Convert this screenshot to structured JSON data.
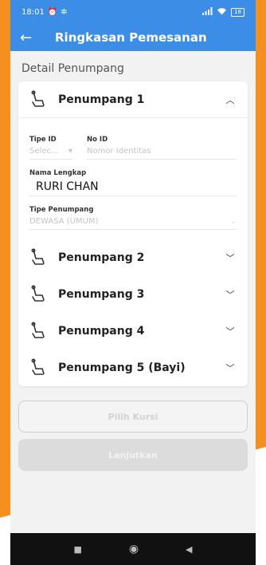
{
  "status_bar": {
    "time": "18:01",
    "left_icons": [
      "alarm-icon",
      "gear-icon"
    ],
    "signal": "4G",
    "battery": "18"
  },
  "app_bar": {
    "title": "Ringkasan Pemesanan",
    "background": "#3b8de6"
  },
  "section_title": "Detail Penumpang",
  "passengers": [
    {
      "label": "Penumpang 1",
      "expanded": true,
      "fields": {
        "tipe_id_label": "Tipe ID",
        "tipe_id_placeholder": "Selec...",
        "no_id_label": "No ID",
        "no_id_placeholder": "Nomor Identitas",
        "nama_label": "Nama Lengkap",
        "nama_value": "RURI CHAN",
        "tipe_penumpang_label": "Tipe Penumpang",
        "tipe_penumpang_value": "DEWASA (UMUM)"
      }
    },
    {
      "label": "Penumpang 2",
      "expanded": false
    },
    {
      "label": "Penumpang 3",
      "expanded": false
    },
    {
      "label": "Penumpang 4",
      "expanded": false
    },
    {
      "label": "Penumpang 5 (Bayi)",
      "expanded": false
    }
  ],
  "buttons": {
    "pilih_kursi": "Pilih Kursi",
    "lanjutkan": "Lanjutkan"
  },
  "colors": {
    "accent": "#3b8de6",
    "orange_bg": "#f5901e"
  }
}
